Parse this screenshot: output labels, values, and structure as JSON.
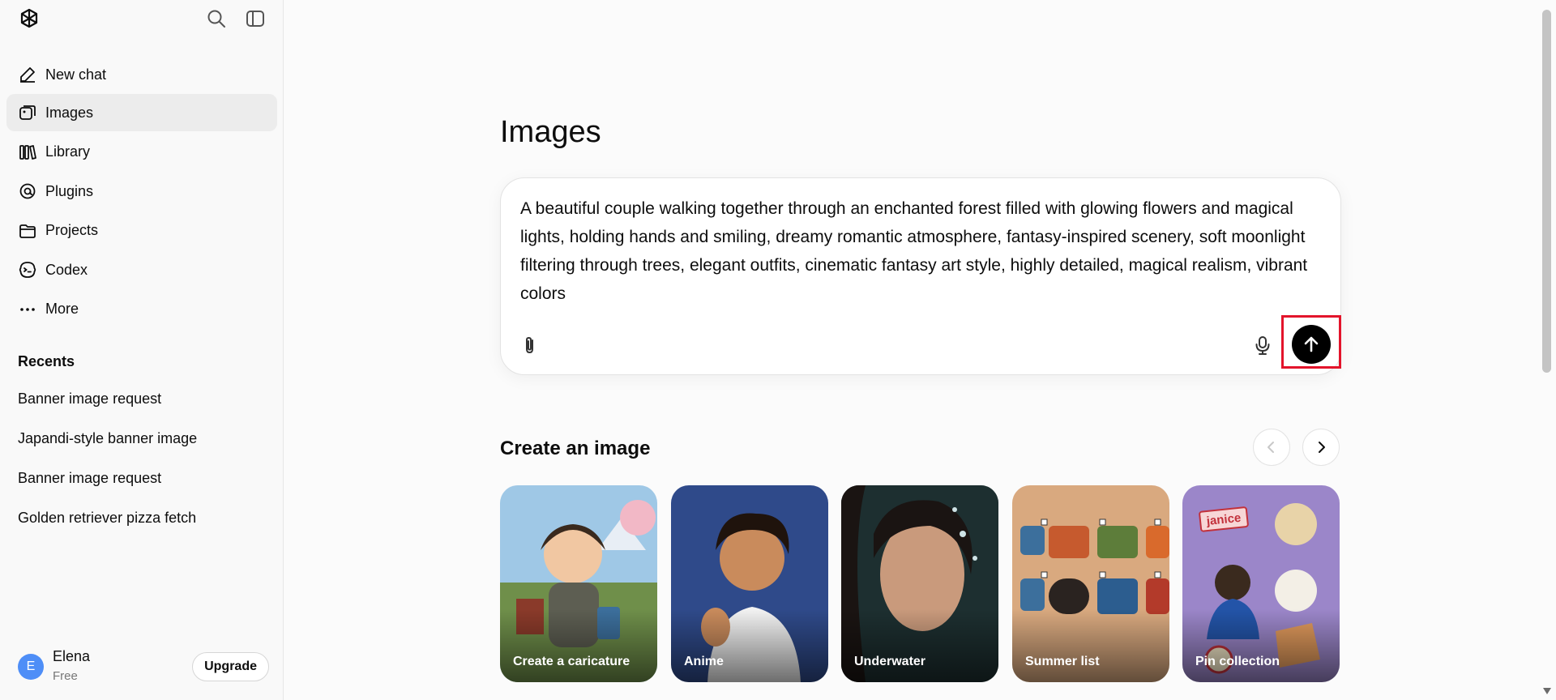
{
  "sidebar": {
    "nav": [
      {
        "label": "New chat",
        "icon": "edit-icon"
      },
      {
        "label": "Images",
        "icon": "images-icon",
        "active": true
      },
      {
        "label": "Library",
        "icon": "library-icon"
      },
      {
        "label": "Plugins",
        "icon": "plugins-icon"
      },
      {
        "label": "Projects",
        "icon": "folder-icon"
      },
      {
        "label": "Codex",
        "icon": "codex-icon"
      },
      {
        "label": "More",
        "icon": "more-icon"
      }
    ],
    "recents_title": "Recents",
    "recents": [
      "Banner image request",
      "Japandi-style banner image",
      "Banner image request",
      "Golden retriever pizza fetch"
    ],
    "user": {
      "initial": "E",
      "name": "Elena",
      "plan": "Free",
      "upgrade_label": "Upgrade"
    }
  },
  "main": {
    "title": "Images",
    "prompt": "A beautiful couple walking together through an enchanted forest filled with glowing flowers and magical lights, holding hands and smiling, dreamy romantic atmosphere, fantasy-inspired scenery, soft moonlight filtering through trees, elegant outfits, cinematic fantasy art style, highly detailed, magical realism, vibrant colors",
    "section_title": "Create an image",
    "cards": [
      {
        "label": "Create a caricature"
      },
      {
        "label": "Anime"
      },
      {
        "label": "Underwater"
      },
      {
        "label": "Summer list"
      },
      {
        "label": "Pin collection"
      }
    ]
  },
  "colors": {
    "accent": "#000000",
    "highlight": "#e3142b",
    "avatar": "#4e8ef7"
  }
}
